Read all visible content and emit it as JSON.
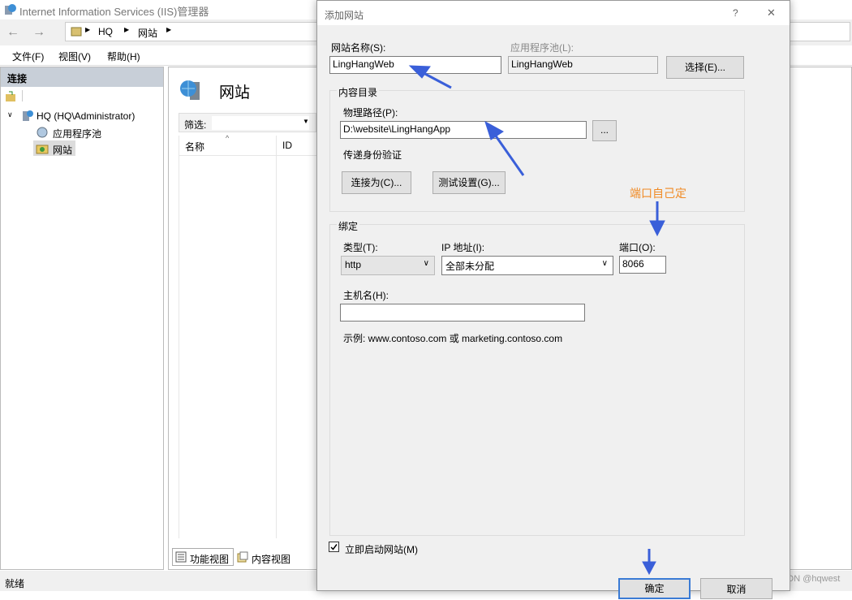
{
  "app": {
    "title": "Internet Information Services (IIS)管理器",
    "breadcrumb": [
      "HQ",
      "网站"
    ],
    "menu": [
      "文件(F)",
      "视图(V)",
      "帮助(H)"
    ]
  },
  "connections": {
    "header": "连接",
    "tree": [
      "HQ (HQ\\Administrator)",
      "应用程序池",
      "网站"
    ]
  },
  "main": {
    "title": "网站",
    "filter_label": "筛选:",
    "columns": [
      "名称",
      "ID"
    ],
    "views": [
      "功能视图",
      "内容视图"
    ]
  },
  "status": "就绪",
  "dialog": {
    "title": "添加网站",
    "help": "?",
    "close": "✕",
    "site_name_label": "网站名称(S):",
    "site_name": "LingHangWeb",
    "app_pool_label": "应用程序池(L):",
    "app_pool": "LingHangWeb",
    "select_button": "选择(E)...",
    "content_group": "内容目录",
    "physical_path_label": "物理路径(P):",
    "physical_path": "D:\\website\\LingHangApp",
    "browse_button": "...",
    "pass_auth": "传递身份验证",
    "connect_as": "连接为(C)...",
    "test_settings": "测试设置(G)...",
    "binding_group": "绑定",
    "type_label": "类型(T):",
    "type_value": "http",
    "ip_label": "IP 地址(I):",
    "ip_value": "全部未分配",
    "port_label": "端口(O):",
    "port_value": "8066",
    "hostname_label": "主机名(H):",
    "hostname_value": "",
    "example": "示例: www.contoso.com 或 marketing.contoso.com",
    "start_immediately": "立即启动网站(M)",
    "ok": "确定",
    "cancel": "取消"
  },
  "annotation": {
    "port_note": "端口自己定",
    "note_color": "#f08a24",
    "arrow_color": "#3a5fd9"
  },
  "watermark": "CSDN @hqwest"
}
